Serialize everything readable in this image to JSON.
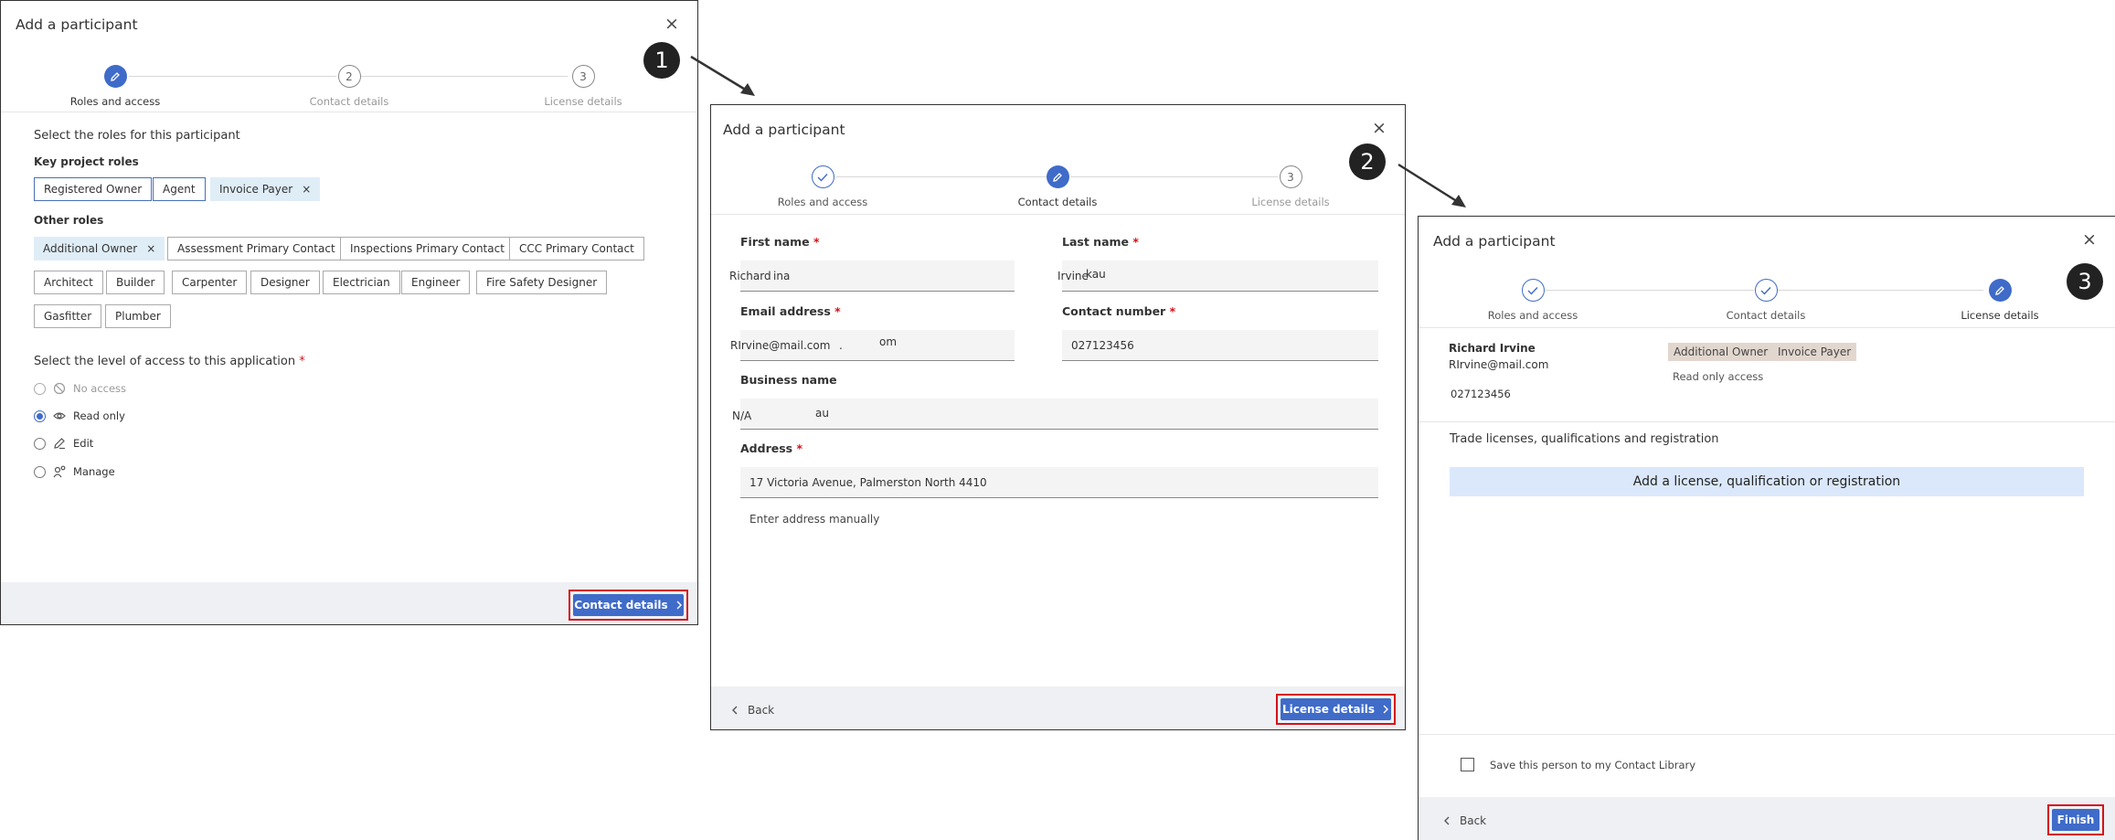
{
  "dialog_title": "Add a participant",
  "close_glyph": "×",
  "steps": [
    "Roles and access",
    "Contact details",
    "License details"
  ],
  "step_numbers": [
    "2",
    "3"
  ],
  "badges": [
    "1",
    "2",
    "3"
  ],
  "d1": {
    "select_roles": "Select the roles for this participant",
    "key_roles_label": "Key project roles",
    "key_roles": [
      "Registered Owner",
      "Agent",
      "Invoice Payer"
    ],
    "other_roles_label": "Other roles",
    "other_roles_row1": [
      "Additional Owner",
      "Assessment Primary Contact",
      "Inspections Primary Contact",
      "CCC Primary Contact"
    ],
    "other_roles_row2": [
      "Architect",
      "Builder",
      "Carpenter",
      "Designer",
      "Electrician",
      "Engineer",
      "Fire Safety Designer"
    ],
    "other_roles_row3": [
      "Gasfitter",
      "Plumber"
    ],
    "remove_glyph": "×",
    "access_label": "Select the level of access to this application",
    "required_mark": "*",
    "access_options": [
      "No access",
      "Read only",
      "Edit",
      "Manage"
    ],
    "selected_access": "Read only",
    "next_button": "Contact details"
  },
  "d2": {
    "first_name_label": "First name",
    "first_name_value": "Richard",
    "first_name_overlay": "ina",
    "last_name_label": "Last name",
    "last_name_value": "Irvine",
    "last_name_overlay": "kau",
    "email_label": "Email address",
    "email_value": "RIrvine@mail.com",
    "email_overlay_dot": ".",
    "email_overlay": "om",
    "contact_label": "Contact number",
    "contact_value": "027123456",
    "business_label": "Business name",
    "business_value": "N/A",
    "business_overlay": "au",
    "address_label": "Address",
    "address_value": "17 Victoria Avenue, Palmerston North 4410",
    "manual_link": "Enter address manually",
    "back": "Back",
    "next_button": "License details"
  },
  "d3": {
    "name": "Richard Irvine",
    "email": "RIrvine@mail.com",
    "phone": "027123456",
    "tags": [
      "Additional Owner",
      "Invoice Payer"
    ],
    "access": "Read only access",
    "licenses_heading": "Trade licenses, qualifications and registration",
    "add_license": "Add a license, qualification or registration",
    "save_contact": "Save this person to my Contact Library",
    "back": "Back",
    "finish": "Finish"
  }
}
